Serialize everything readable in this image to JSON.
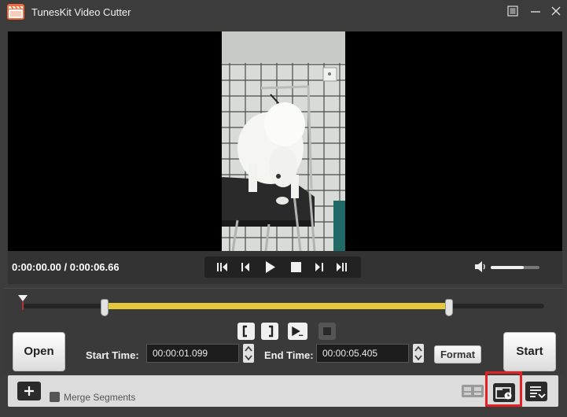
{
  "window": {
    "title": "TunesKit Video Cutter",
    "logo_icon": "film-clapper-icon",
    "menu_icon": "menu-list-icon",
    "minimize_icon": "minimize-icon",
    "close_icon": "close-icon"
  },
  "player": {
    "time_display": "0:00:00.00 / 0:00:06.66",
    "transport_icons": [
      "skip-to-start-icon",
      "step-back-icon",
      "play-icon",
      "stop-icon",
      "step-forward-icon",
      "skip-to-end-icon"
    ],
    "volume_icon": "volume-icon",
    "volume_level": 0.68
  },
  "editor": {
    "playhead_icon": "playhead-marker-icon",
    "segment_controls": [
      "set-start-bracket-icon",
      "set-end-bracket-icon",
      "preview-segment-icon",
      "stop-preview-icon"
    ],
    "open_label": "Open",
    "start_time_label": "Start Time:",
    "start_time_value": "00:00:01.099",
    "end_time_label": "End Time:",
    "end_time_value": "00:00:05.405",
    "format_label": "Format",
    "start_label": "Start"
  },
  "bottom": {
    "add_icon": "plus-icon",
    "merge_label": "Merge Segments",
    "merge_checked": false,
    "segment_icon": "segments-edit-icon",
    "output_folder_icon": "output-folder-icon",
    "list_icon": "task-list-icon"
  },
  "colors": {
    "accent_yellow": "#e5c93d",
    "highlight_red": "#e52025",
    "logo_orange": "#f26a3b"
  }
}
